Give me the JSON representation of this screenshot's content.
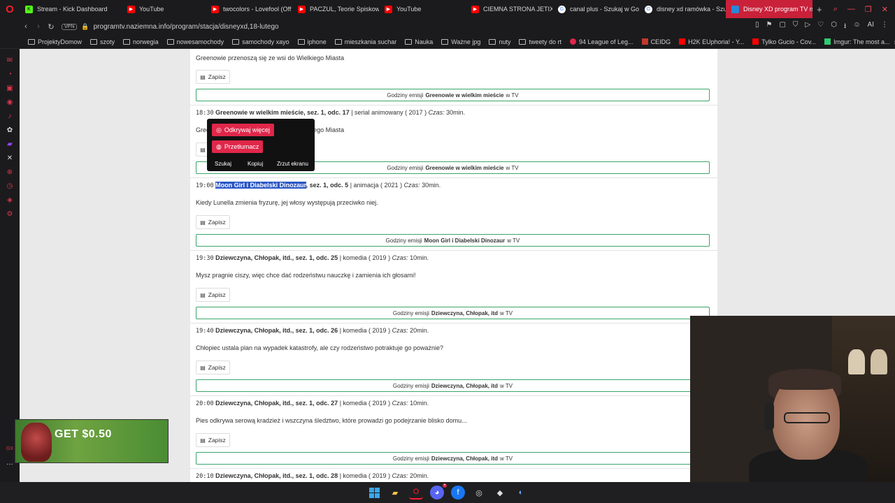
{
  "tabs": [
    {
      "label": "Stream - Kick Dashboard",
      "icon": "kick-icon",
      "color": "#53fc18"
    },
    {
      "label": "YouTube",
      "icon": "youtube-icon",
      "color": "#ff0000"
    },
    {
      "label": "twocolors - Lovefool (Off",
      "icon": "youtube-icon",
      "color": "#ff0000"
    },
    {
      "label": "PACZUL, Teorie Spiskow",
      "icon": "youtube-icon",
      "color": "#ff0000"
    },
    {
      "label": "YouTube",
      "icon": "youtube-icon",
      "color": "#ff0000"
    },
    {
      "label": "CIEMNA STRONA JETIX",
      "icon": "youtube-icon",
      "color": "#ff0000"
    },
    {
      "label": "canal plus - Szukaj w Go",
      "icon": "google-icon",
      "color": "#ffffff"
    },
    {
      "label": "disney xd ramówka - Szu",
      "icon": "google-icon",
      "color": "#ffffff"
    },
    {
      "label": "Disney XD program TV na",
      "icon": "page-icon",
      "color": "#2a88d8"
    }
  ],
  "address": {
    "vpn": "VPN",
    "url": "programtv.naziemna.info/program/stacja/disneyxd,18-lutego"
  },
  "bookmarks": [
    {
      "label": "ProjektyDomow",
      "icon": "folder-icon"
    },
    {
      "label": "szoty",
      "icon": "folder-icon"
    },
    {
      "label": "norwegia",
      "icon": "folder-icon"
    },
    {
      "label": "nowesamochody",
      "icon": "folder-icon"
    },
    {
      "label": "samochody xayo",
      "icon": "folder-icon"
    },
    {
      "label": "iphone",
      "icon": "folder-icon"
    },
    {
      "label": "mieszkania suchar",
      "icon": "folder-icon"
    },
    {
      "label": "Nauka",
      "icon": "folder-icon"
    },
    {
      "label": "Ważne jpg",
      "icon": "folder-icon"
    },
    {
      "label": "nuty",
      "icon": "folder-icon"
    },
    {
      "label": "tweety do rt",
      "icon": "folder-icon"
    },
    {
      "label": "94 League of Leg...",
      "icon": "site-icon"
    },
    {
      "label": "CEIDG",
      "icon": "site-icon"
    },
    {
      "label": "H2K EUphoria! - Y...",
      "icon": "site-icon"
    },
    {
      "label": "Tylko Gucio - Cov...",
      "icon": "site-icon"
    },
    {
      "label": "Imgur: The most a...",
      "icon": "site-icon"
    }
  ],
  "program": {
    "top_desc": "Greenowie przenoszą się ze wsi do Wielkiego Miasta",
    "save_label": "Zapisz",
    "godziny_prefix": "Godziny emisji",
    "godziny_suffix": "w TV",
    "entries": [
      {
        "time": "18:30",
        "title": "Greenowie w wielkim mieście, sez. 1, odc. 17",
        "meta": "| serial animowany ( 2017 )",
        "duration_label": "Czas:",
        "duration": "30min.",
        "desc": "Greenowie przenoszą się ze wsi do Wielkiego Miasta",
        "show": "Greenowie w wielkim mieście"
      },
      {
        "time": "19:00",
        "title_selected": "Moon Girl i Diabelski Dinozaur",
        "title_rest": ", sez. 1, odc. 5",
        "meta": "| animacja ( 2021 )",
        "duration_label": "Czas:",
        "duration": "30min.",
        "desc": "Kiedy Lunella zmienia fryzurę, jej włosy występują przeciwko niej.",
        "show": "Moon Girl i Diabelski Dinozaur"
      },
      {
        "time": "19:30",
        "title": "Dziewczyna, Chłopak, itd., sez. 1, odc. 25",
        "meta": "| komedia ( 2019 )",
        "duration_label": "Czas:",
        "duration": "10min.",
        "desc": "Mysz pragnie ciszy, więc chce dać rodzeństwu nauczkę i zamienia ich głosami!",
        "show": "Dziewczyna, Chłopak, itd"
      },
      {
        "time": "19:40",
        "title": "Dziewczyna, Chłopak, itd., sez. 1, odc. 26",
        "meta": "| komedia ( 2019 )",
        "duration_label": "Czas:",
        "duration": "20min.",
        "desc": "Chłopiec ustala plan na wypadek katastrofy, ale czy rodzeństwo potraktuje go poważnie?",
        "show": "Dziewczyna, Chłopak, itd"
      },
      {
        "time": "20:00",
        "title": "Dziewczyna, Chłopak, itd., sez. 1, odc. 27",
        "meta": "| komedia ( 2019 )",
        "duration_label": "Czas:",
        "duration": "10min.",
        "desc": "Pies odkrywa serową kradzież i wszczyna śledztwo, które prowadzi go podejrzanie blisko domu...",
        "show": "Dziewczyna, Chłopak, itd"
      },
      {
        "time": "20:10",
        "title": "Dziewczyna, Chłopak, itd., sez. 1, odc. 28",
        "meta": "| komedia ( 2019 )",
        "duration_label": "Czas:",
        "duration": "20min."
      }
    ]
  },
  "popup": {
    "discover": "Odkrywaj więcej",
    "translate": "Przetłumacz",
    "search": "Szukaj",
    "copy": "Kopiuj",
    "screenshot": "Zrzut ekranu"
  },
  "ad": {
    "text": "GET $0.50"
  },
  "colors": {
    "accent": "#e0274a",
    "godziny_border": "#3aa56b",
    "selection": "#2a56c6"
  }
}
